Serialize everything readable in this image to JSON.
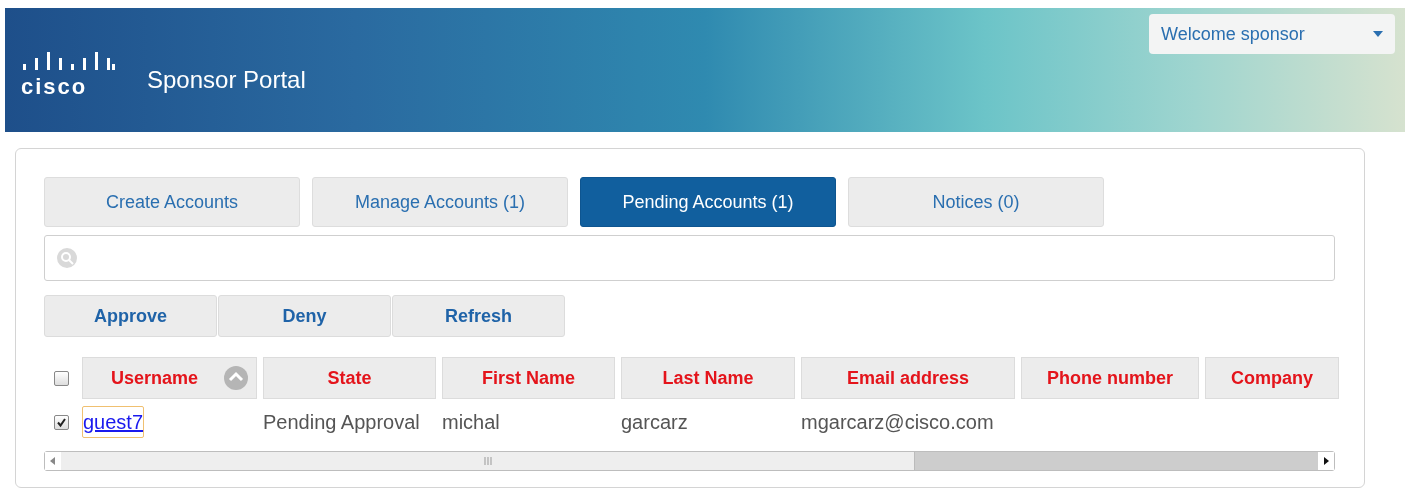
{
  "header": {
    "logo_text": "cisco",
    "title": "Sponsor Portal",
    "user_menu": "Welcome sponsor"
  },
  "tabs": [
    {
      "label": "Create Accounts",
      "selected": false
    },
    {
      "label": "Manage Accounts (1)",
      "selected": false
    },
    {
      "label": "Pending Accounts (1)",
      "selected": true
    },
    {
      "label": "Notices (0)",
      "selected": false
    }
  ],
  "actions": [
    "Approve",
    "Deny",
    "Refresh"
  ],
  "table": {
    "select_all_checked": false,
    "columns": [
      {
        "label": "Username",
        "sorted": true
      },
      {
        "label": "State",
        "sorted": false
      },
      {
        "label": "First Name",
        "sorted": false
      },
      {
        "label": "Last Name",
        "sorted": false
      },
      {
        "label": "Email address",
        "sorted": false
      },
      {
        "label": "Phone number",
        "sorted": false
      },
      {
        "label": "Company",
        "sorted": false
      }
    ],
    "rows": [
      {
        "selected": true,
        "cells": [
          {
            "text": "guest7",
            "kind": "link"
          },
          {
            "text": "Pending Approval",
            "kind": "text"
          },
          {
            "text": "michal",
            "kind": "text"
          },
          {
            "text": "garcarz",
            "kind": "text"
          },
          {
            "text": "mgarcarz@cisco.com",
            "kind": "text"
          }
        ]
      }
    ]
  }
}
